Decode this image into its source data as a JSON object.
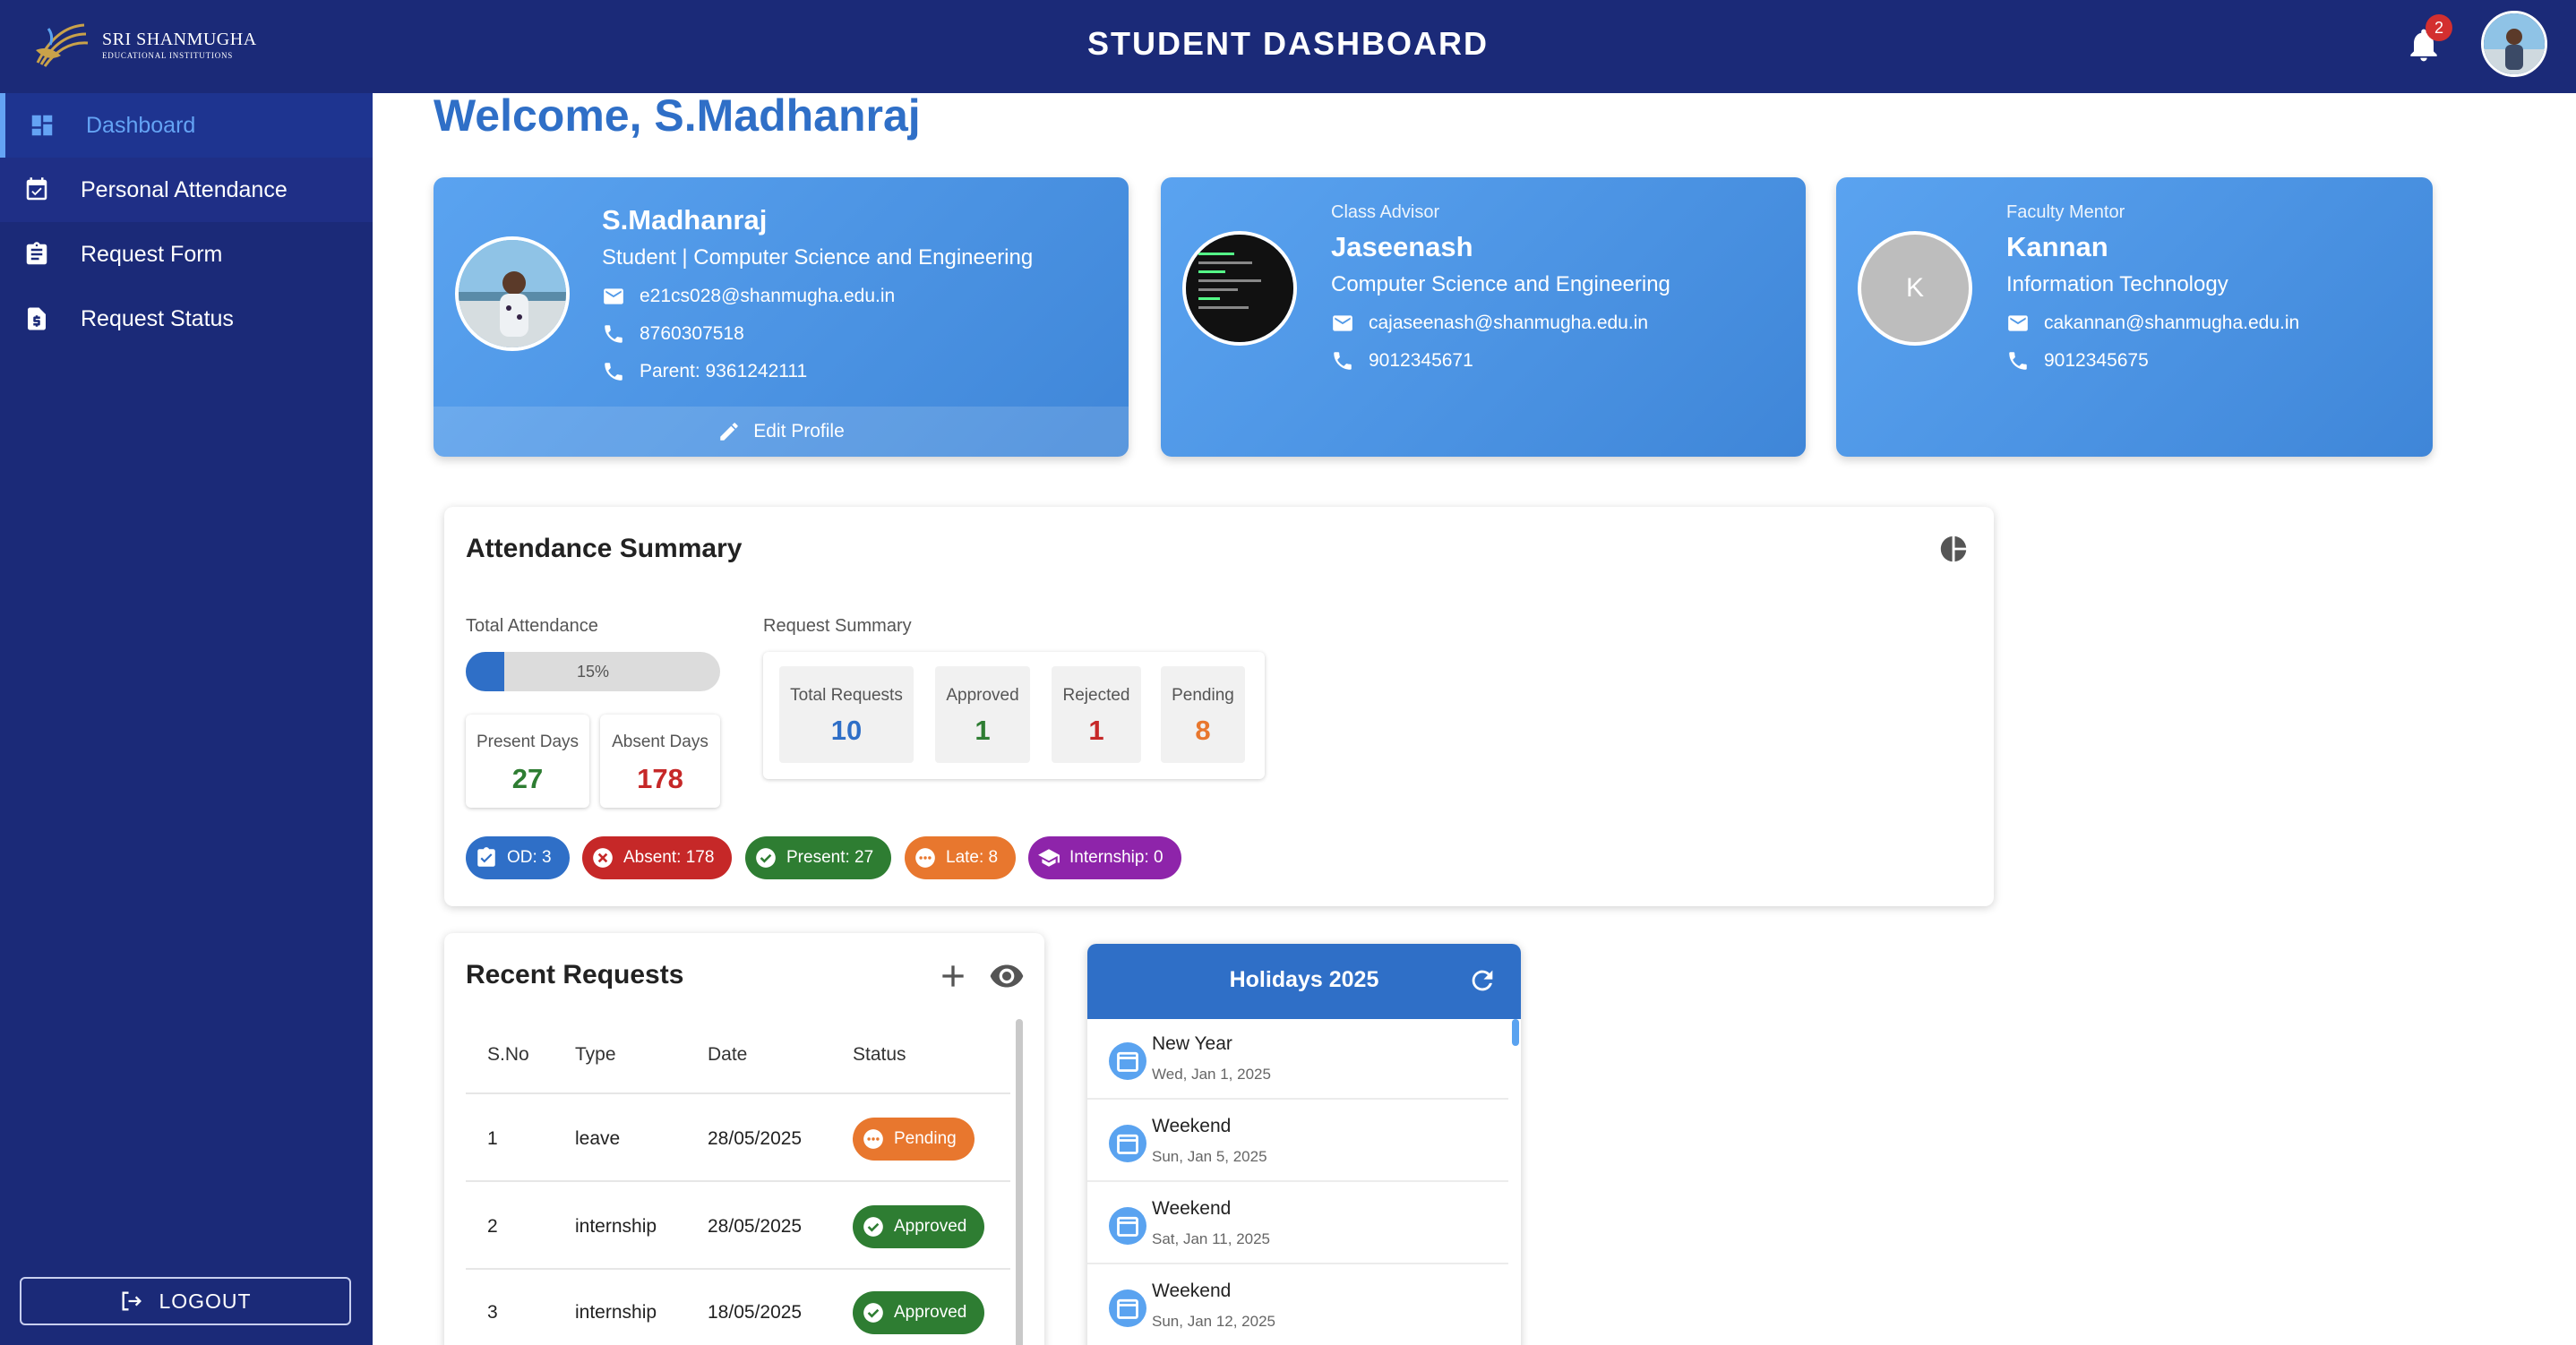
{
  "header": {
    "logo_line1": "SRI SHANMUGHA",
    "logo_line2": "EDUCATIONAL INSTITUTIONS",
    "title": "STUDENT DASHBOARD",
    "notification_count": "2"
  },
  "sidebar": {
    "items": [
      {
        "label": "Dashboard",
        "icon": "dashboard-icon"
      },
      {
        "label": "Personal Attendance",
        "icon": "calendar-check-icon"
      },
      {
        "label": "Request Form",
        "icon": "clipboard-icon"
      },
      {
        "label": "Request Status",
        "icon": "dollar-file-icon"
      }
    ],
    "logout_label": "LOGOUT"
  },
  "welcome": "Welcome, S.Madhanraj",
  "student": {
    "name": "S.Madhanraj",
    "role": "Student | Computer Science and Engineering",
    "email": "e21cs028@shanmugha.edu.in",
    "phone": "8760307518",
    "parent": "Parent: 9361242111",
    "edit_label": "Edit Profile"
  },
  "advisor": {
    "label": "Class Advisor",
    "name": "Jaseenash",
    "dept": "Computer Science and Engineering",
    "email": "cajaseenash@shanmugha.edu.in",
    "phone": "9012345671"
  },
  "mentor": {
    "label": "Faculty Mentor",
    "initial": "K",
    "name": "Kannan",
    "dept": "Information Technology",
    "email": "cakannan@shanmugha.edu.in",
    "phone": "9012345675"
  },
  "attendance": {
    "title": "Attendance Summary",
    "total_label": "Total Attendance",
    "percent": 15,
    "percent_text": "15%",
    "present_label": "Present Days",
    "present_value": "27",
    "absent_label": "Absent Days",
    "absent_value": "178",
    "request_summary_label": "Request Summary",
    "requests": {
      "total_label": "Total Requests",
      "total_value": "10",
      "approved_label": "Approved",
      "approved_value": "1",
      "rejected_label": "Rejected",
      "rejected_value": "1",
      "pending_label": "Pending",
      "pending_value": "8"
    },
    "chips": {
      "od": "OD: 3",
      "absent": "Absent: 178",
      "present": "Present: 27",
      "late": "Late: 8",
      "internship": "Internship: 0"
    }
  },
  "recent_requests": {
    "title": "Recent Requests",
    "columns": [
      "S.No",
      "Type",
      "Date",
      "Status"
    ],
    "rows": [
      {
        "sno": "1",
        "type": "leave",
        "date": "28/05/2025",
        "status": "Pending"
      },
      {
        "sno": "2",
        "type": "internship",
        "date": "28/05/2025",
        "status": "Approved"
      },
      {
        "sno": "3",
        "type": "internship",
        "date": "18/05/2025",
        "status": "Approved"
      }
    ]
  },
  "holidays": {
    "title": "Holidays 2025",
    "items": [
      {
        "name": "New Year",
        "date": "Wed, Jan 1, 2025"
      },
      {
        "name": "Weekend",
        "date": "Sun, Jan 5, 2025"
      },
      {
        "name": "Weekend",
        "date": "Sat, Jan 11, 2025"
      },
      {
        "name": "Weekend",
        "date": "Sun, Jan 12, 2025"
      }
    ]
  },
  "colors": {
    "navy": "#1b2a78",
    "blue": "#2f6fc7",
    "green": "#2e7d32",
    "red": "#c62828",
    "orange": "#e8772e",
    "purple": "#8e24aa"
  }
}
